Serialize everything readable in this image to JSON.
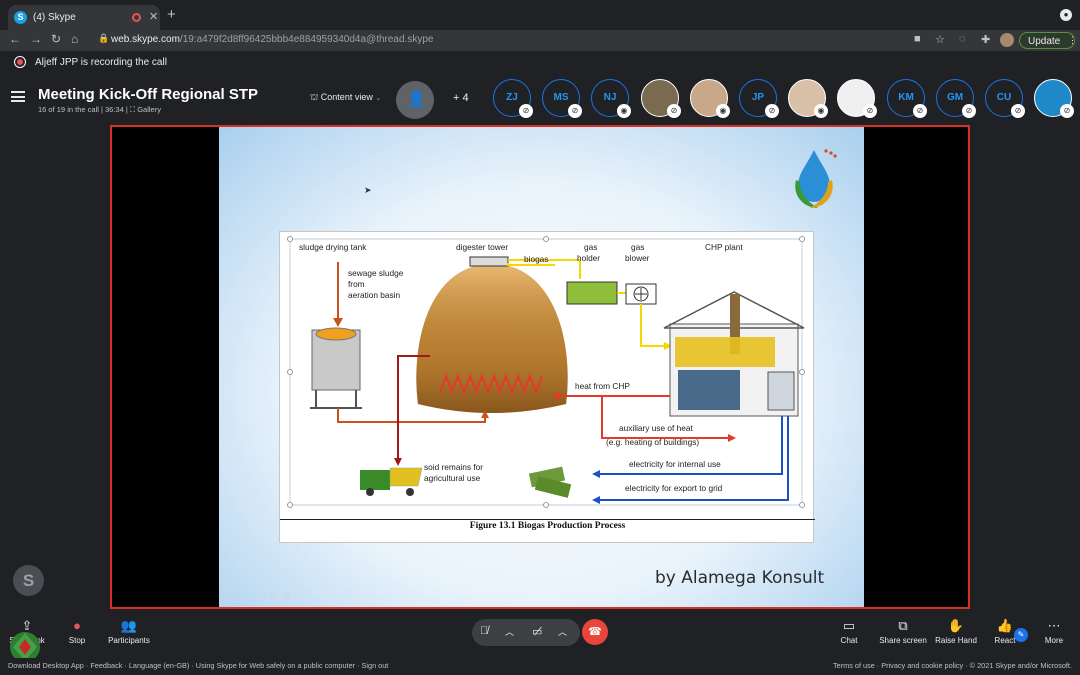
{
  "browser": {
    "tab_title": "(4) Skype",
    "url_host": "web.skype.com",
    "url_path": "/19:a479f2d8ff96425bbb4e884959340d4a@thread.skype",
    "update_label": "Update"
  },
  "recording": {
    "text": "Aljeff JPP is recording the call"
  },
  "meeting": {
    "title": "Meeting Kick-Off Regional STP",
    "subtitle": "16 of 19 in the call | 36:34 | ⛶ Gallery",
    "content_view": "Content view",
    "more_count": "+ 4",
    "participants": [
      {
        "initials": "ZJ",
        "muted": true
      },
      {
        "initials": "MS",
        "muted": true
      },
      {
        "initials": "NJ",
        "muted": false
      },
      {
        "initials": "",
        "photo": true,
        "muted": true
      },
      {
        "initials": "",
        "photo": true,
        "muted": false
      },
      {
        "initials": "JP",
        "muted": true
      },
      {
        "initials": "",
        "photo": true,
        "muted": false
      },
      {
        "initials": "",
        "photo": true,
        "muted": true
      },
      {
        "initials": "KM",
        "muted": true
      },
      {
        "initials": "GM",
        "muted": true
      },
      {
        "initials": "CU",
        "muted": true
      },
      {
        "initials": "",
        "photo": true,
        "muted": true
      }
    ]
  },
  "slide": {
    "byline": "by Alamega Konsult",
    "figure_caption": "Figure  13.1 Biogas Production  Process",
    "labels": {
      "sludge_tank": "sludge drying tank",
      "sewage": "sewage sludge",
      "from": "from",
      "aeration": "aeration basin",
      "digester": "digester tower",
      "biogas": "biogas",
      "gas_holder_1": "gas",
      "gas_holder_2": "holder",
      "gas_blower_1": "gas",
      "gas_blower_2": "blower",
      "chp": "CHP plant",
      "heat_from_chp": "heat from CHP",
      "aux_heat": "auxiliary use of heat",
      "aux_eg": "(e.g. heating of buildings)",
      "elec_internal": "electricity for internal use",
      "elec_export": "electricity for export to grid",
      "solid_1": "soid remains for",
      "solid_2": "agricultural use"
    }
  },
  "controls": {
    "share_link": "Share link",
    "stop": "Stop",
    "participants": "Participants",
    "chat": "Chat",
    "share_screen": "Share screen",
    "raise_hand": "Raise Hand",
    "react": "React",
    "more": "More"
  },
  "footer": {
    "left": "Download Desktop App  ·  Feedback  ·  Language (en-GB)  ·  Using Skype for Web safely on a public computer  ·  Sign out",
    "right": "Terms of use  ·  Privacy and cookie policy  ·  © 2021 Skype and/or Microsoft."
  },
  "colors": {
    "accent": "#1a73e8",
    "record": "#e8545a",
    "end_call": "#e8453c",
    "stage_border": "#d93025"
  }
}
